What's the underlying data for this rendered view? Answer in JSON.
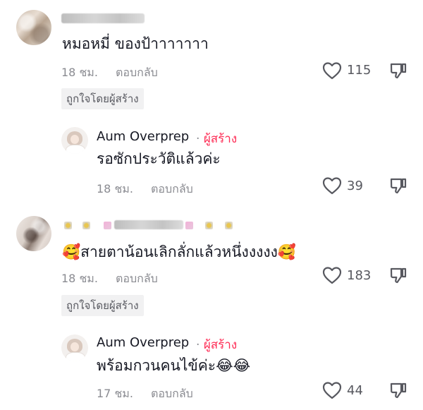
{
  "comments": [
    {
      "text": "หมอหมี่ ของป้าาาาาาา",
      "time": "18 ชม.",
      "reply_label": "ตอบกลับ",
      "likes": "115",
      "liked_by_creator": "ถูกใจโดยผู้สร้าง",
      "reply": {
        "username": "Aum Overprep",
        "separator": "·",
        "creator_label": "ผู้สร้าง",
        "text": "รอซักประวัติแล้วค่ะ",
        "time": "18 ชม.",
        "reply_label": "ตอบกลับ",
        "likes": "39"
      }
    },
    {
      "text_emoji_lead": "🥰",
      "text": "สายตาน้อนเลิกลั่กแล้วหนึ่งงงงง",
      "text_emoji_trail": "🥰",
      "time": "18 ชม.",
      "reply_label": "ตอบกลับ",
      "likes": "183",
      "liked_by_creator": "ถูกใจโดยผู้สร้าง",
      "reply": {
        "username": "Aum Overprep",
        "separator": "·",
        "creator_label": "ผู้สร้าง",
        "text": "พร้อมกวนคนไข้ค่ะ",
        "text_emojis": "😂😂",
        "time": "17 ชม.",
        "reply_label": "ตอบกลับ",
        "likes": "44"
      }
    }
  ],
  "colors": {
    "creator": "#fe2c55",
    "muted": "#8a8b91",
    "text": "#161823",
    "badge_bg": "#f1f1f2"
  },
  "icons": [
    "heart-outline-icon",
    "thumbs-down-icon"
  ]
}
